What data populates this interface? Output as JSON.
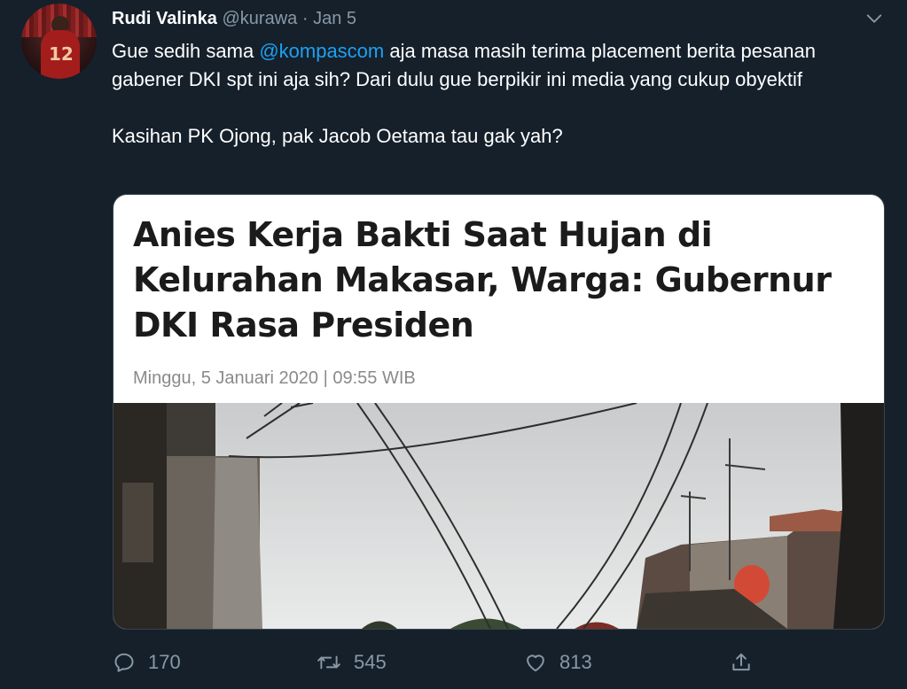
{
  "tweet": {
    "author_name": "Rudi Valinka",
    "handle": "@kurawa",
    "separator": "·",
    "date": "Jan 5",
    "text_before_mention": "Gue sedih sama ",
    "mention": "@kompascom",
    "text_after_mention": " aja masa masih terima placement berita pesanan gabener DKI spt ini aja sih? Dari dulu gue berpikir ini media yang cukup obyektif",
    "text_second_paragraph": "Kasihan PK Ojong, pak Jacob Oetama tau gak yah?",
    "avatar_number": "12"
  },
  "card": {
    "headline": "Anies Kerja Bakti Saat Hujan di Kelurahan Makasar, Warga: Gubernur DKI Rasa Presiden",
    "dateline": "Minggu, 5 Januari 2020 | 09:55 WIB"
  },
  "actions": {
    "reply_count": "170",
    "retweet_count": "545",
    "like_count": "813"
  },
  "icons": {
    "reply": "reply-icon",
    "retweet": "retweet-icon",
    "like": "heart-icon",
    "share": "share-icon",
    "more": "chevron-down-icon"
  },
  "colors": {
    "background": "#15202b",
    "text": "#ffffff",
    "muted": "#8899a6",
    "accent": "#1da1f2",
    "border": "#38444d"
  }
}
